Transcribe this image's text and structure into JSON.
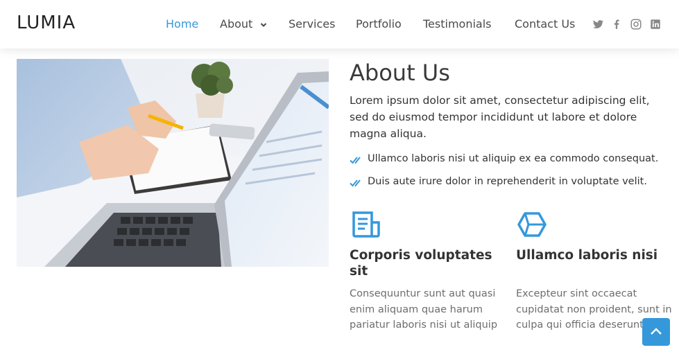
{
  "header": {
    "logo": "LUMIA",
    "nav": [
      {
        "label": "Home"
      },
      {
        "label": "About"
      },
      {
        "label": "Services"
      },
      {
        "label": "Portfolio"
      },
      {
        "label": "Testimonials"
      },
      {
        "label": "Contact Us"
      }
    ],
    "active_nav": "Home",
    "social_icons": [
      "twitter-icon",
      "facebook-icon",
      "instagram-icon",
      "linkedin-icon"
    ]
  },
  "about": {
    "title": "About Us",
    "description": "Lorem ipsum dolor sit amet, consectetur adipiscing elit, sed do eiusmod tempor incididunt ut labore et dolore magna aliqua.",
    "checks": [
      "Ullamco laboris nisi ut aliquip ex ea commodo consequat.",
      "Duis aute irure dolor in reprehenderit in voluptate velit."
    ],
    "features": [
      {
        "icon": "receipt-icon",
        "title": "Corporis voluptates sit",
        "description": "Consequuntur sunt aut quasi enim aliquam quae harum pariatur laboris nisi ut aliquip"
      },
      {
        "icon": "cube-icon",
        "title": "Ullamco laboris nisi",
        "description": "Excepteur sint occaecat cupidatat non proident, sunt in culpa qui officia deserunt"
      }
    ]
  },
  "colors": {
    "accent": "#3498db",
    "heading": "#3a3a3a",
    "body_text": "#333333",
    "muted_text": "#6d6d6d",
    "nav_text": "#4a4a4a",
    "social_icon": "#888888"
  },
  "back_to_top": {
    "icon": "arrow-up-icon"
  }
}
